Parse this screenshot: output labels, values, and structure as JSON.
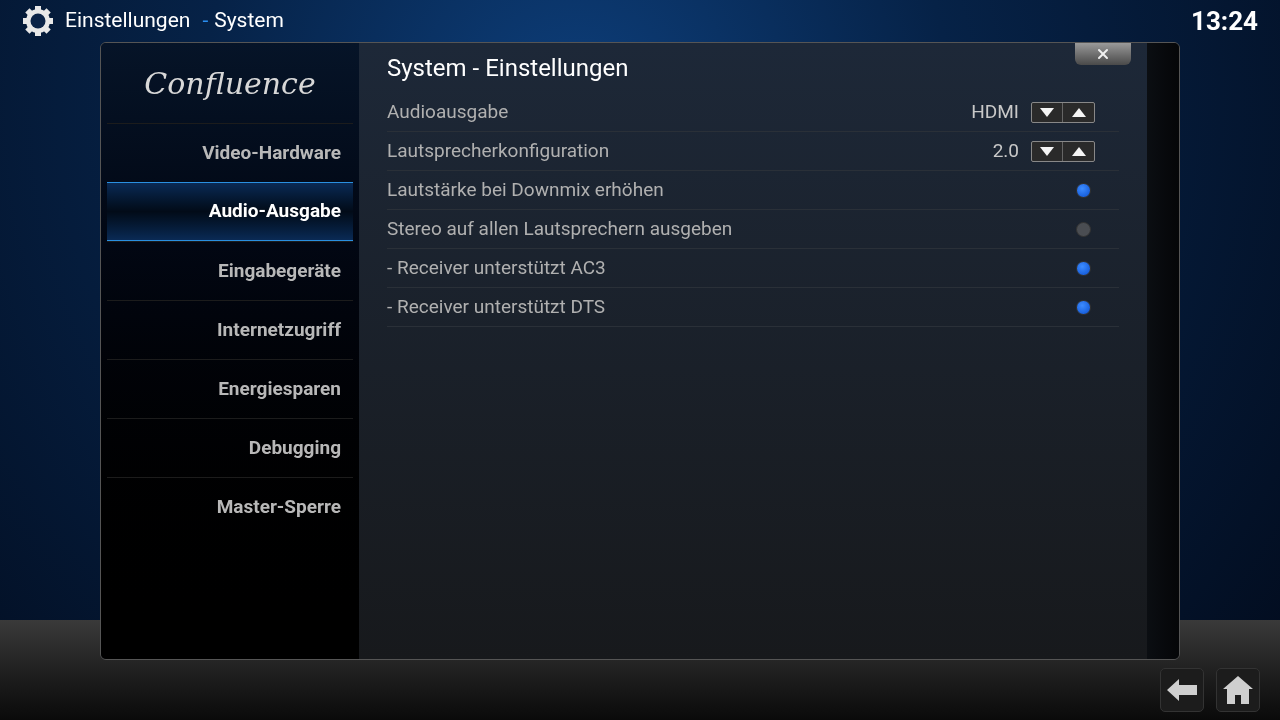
{
  "header": {
    "section": "Einstellungen",
    "separator": "-",
    "page": "System",
    "clock": "13:24"
  },
  "sidebar": {
    "logo": "Confluence",
    "items": [
      {
        "label": "Video-Hardware",
        "selected": false
      },
      {
        "label": "Audio-Ausgabe",
        "selected": true
      },
      {
        "label": "Eingabegeräte",
        "selected": false
      },
      {
        "label": "Internetzugriff",
        "selected": false
      },
      {
        "label": "Energiesparen",
        "selected": false
      },
      {
        "label": "Debugging",
        "selected": false
      },
      {
        "label": "Master-Sperre",
        "selected": false
      }
    ]
  },
  "dialog": {
    "title": "System - Einstellungen"
  },
  "settings": [
    {
      "kind": "spinner",
      "label": "Audioausgabe",
      "value": "HDMI"
    },
    {
      "kind": "spinner",
      "label": "Lautsprecherkonfiguration",
      "value": "2.0"
    },
    {
      "kind": "toggle",
      "label": "Lautstärke bei Downmix erhöhen",
      "on": true
    },
    {
      "kind": "toggle",
      "label": "Stereo auf allen Lautsprechern ausgeben",
      "on": false
    },
    {
      "kind": "toggle",
      "label": "- Receiver unterstützt AC3",
      "on": true
    },
    {
      "kind": "toggle",
      "label": "- Receiver unterstützt DTS",
      "on": true
    }
  ]
}
